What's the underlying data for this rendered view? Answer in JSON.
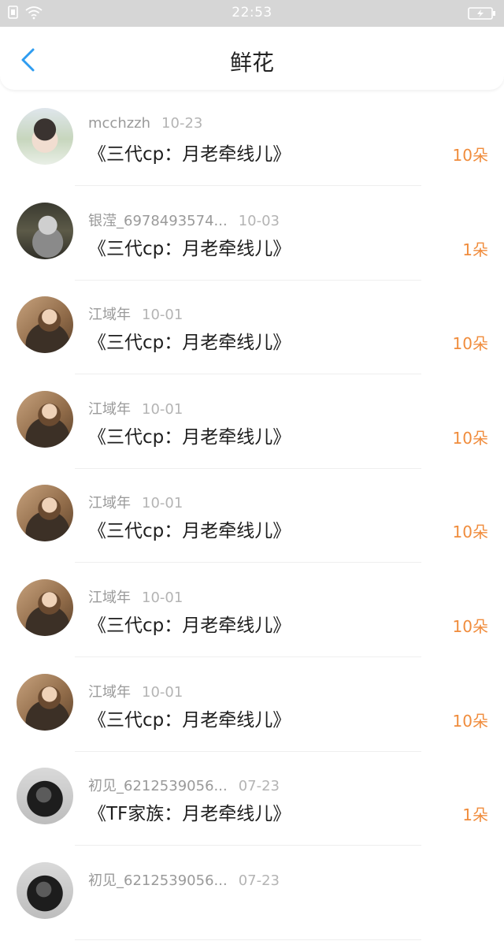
{
  "status_bar": {
    "time": "22:53"
  },
  "header": {
    "title": "鲜花"
  },
  "flowers": [
    {
      "user": "mcchzzh",
      "date": "10-23",
      "book": "《三代cp：月老牵线儿》",
      "count": "10朵",
      "avatar": "boy"
    },
    {
      "user": "银滢_6978493574...",
      "date": "10-03",
      "book": "《三代cp：月老牵线儿》",
      "count": "1朵",
      "avatar": "hood"
    },
    {
      "user": "江域年",
      "date": "10-01",
      "book": "《三代cp：月老牵线儿》",
      "count": "10朵",
      "avatar": "girl"
    },
    {
      "user": "江域年",
      "date": "10-01",
      "book": "《三代cp：月老牵线儿》",
      "count": "10朵",
      "avatar": "girl"
    },
    {
      "user": "江域年",
      "date": "10-01",
      "book": "《三代cp：月老牵线儿》",
      "count": "10朵",
      "avatar": "girl"
    },
    {
      "user": "江域年",
      "date": "10-01",
      "book": "《三代cp：月老牵线儿》",
      "count": "10朵",
      "avatar": "girl"
    },
    {
      "user": "江域年",
      "date": "10-01",
      "book": "《三代cp：月老牵线儿》",
      "count": "10朵",
      "avatar": "girl"
    },
    {
      "user": "初见_6212539056...",
      "date": "07-23",
      "book": "《TF家族：月老牵线儿》",
      "count": "1朵",
      "avatar": "dark"
    },
    {
      "user": "初见_6212539056...",
      "date": "07-23",
      "book": "",
      "count": "",
      "avatar": "dark"
    }
  ]
}
